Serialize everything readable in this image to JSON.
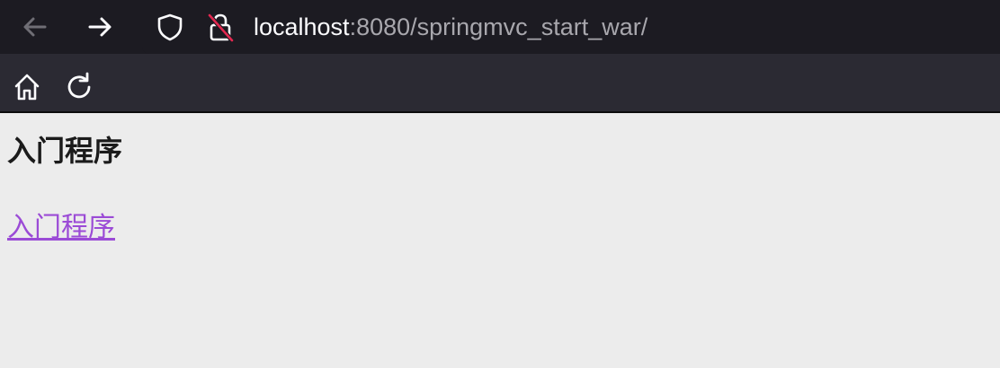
{
  "browser": {
    "url_host": "localhost",
    "url_rest": ":8080/springmvc_start_war/",
    "icons": {
      "back": "arrow-left-icon",
      "forward": "arrow-right-icon",
      "shield": "shield-icon",
      "insecure_lock": "insecure-lock-icon",
      "home": "home-icon",
      "reload": "reload-icon"
    },
    "colors": {
      "chrome_dark": "#1c1b22",
      "chrome": "#2b2a33",
      "url_host": "#fbfbfe",
      "url_rest": "#a8a7ad",
      "insecure_slash": "#e22850"
    }
  },
  "page": {
    "heading": "入门程序",
    "link_text": "入门程序",
    "colors": {
      "background": "#ececec",
      "text": "#1b1b1b",
      "visited_link": "#9b4bd6"
    }
  }
}
